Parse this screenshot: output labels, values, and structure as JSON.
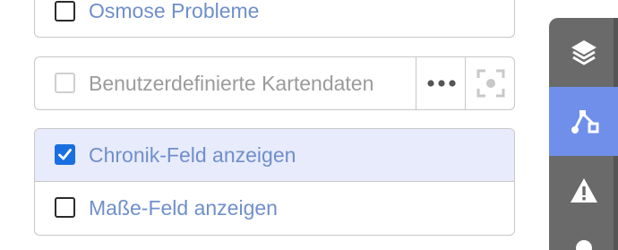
{
  "options": {
    "osmose": {
      "label": "Osmose Probleme",
      "checked": false
    },
    "custom_map": {
      "label": "Benutzerdefinierte Kartendaten",
      "checked": false,
      "disabled": true
    },
    "history_panel": {
      "label": "Chronik-Feld anzeigen",
      "checked": true
    },
    "measure_panel": {
      "label": "Maße-Feld anzeigen",
      "checked": false
    }
  },
  "colors": {
    "accent": "#1a6fe0",
    "label": "#6f8fcb",
    "highlight_row": "#e8ebfb",
    "sidebar": "#6a6a6a",
    "sidebar_active": "#6f8fea"
  },
  "icons": {
    "more": "ellipsis-icon",
    "zoom": "zoom-to-data-icon",
    "layers": "layers-icon",
    "data": "data-nodes-icon",
    "issues": "warning-icon",
    "other": "map-pin-icon"
  }
}
